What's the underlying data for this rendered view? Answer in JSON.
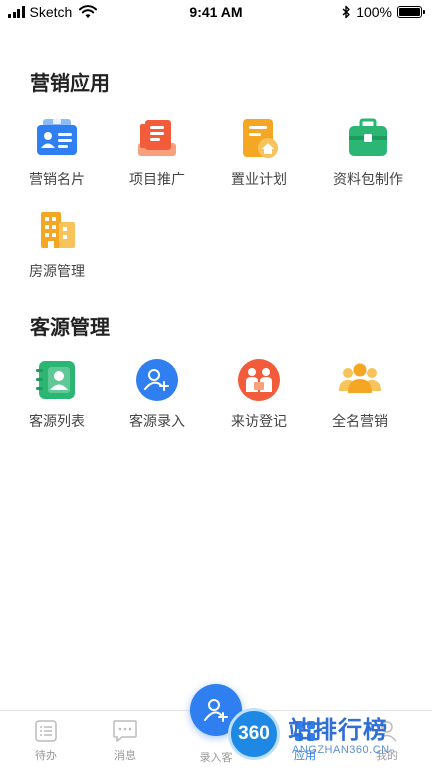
{
  "status_bar": {
    "carrier": "Sketch",
    "time": "9:41 AM",
    "battery": "100%"
  },
  "sections": [
    {
      "title": "营销应用",
      "items": [
        {
          "label": "营销名片",
          "icon": "business-card-icon"
        },
        {
          "label": "项目推广",
          "icon": "project-promotion-icon"
        },
        {
          "label": "置业计划",
          "icon": "home-plan-icon"
        },
        {
          "label": "资料包制作",
          "icon": "briefcase-icon"
        },
        {
          "label": "房源管理",
          "icon": "building-icon"
        }
      ]
    },
    {
      "title": "客源管理",
      "items": [
        {
          "label": "客源列表",
          "icon": "contact-book-icon"
        },
        {
          "label": "客源录入",
          "icon": "add-user-icon"
        },
        {
          "label": "来访登记",
          "icon": "visitor-register-icon"
        },
        {
          "label": "全名营销",
          "icon": "group-icon"
        }
      ]
    }
  ],
  "tab_bar": {
    "tabs": [
      {
        "label": "待办",
        "icon": "todo-list-icon"
      },
      {
        "label": "消息",
        "icon": "message-icon"
      },
      {
        "label": "录入客",
        "icon": "add-customer-icon"
      },
      {
        "label": "应用",
        "icon": "apps-icon",
        "active": true
      },
      {
        "label": "我的",
        "icon": "profile-icon"
      }
    ],
    "active_color": "#2f7ff0",
    "inactive_color": "#999999"
  },
  "watermark": {
    "logo_text": "360",
    "title": "站排行榜",
    "subtitle": "ANGZHAN360.CN-"
  },
  "colors": {
    "primary": "#2f7ff0",
    "orange": "#f5a623",
    "green": "#2bb673",
    "red": "#f25c3b"
  }
}
